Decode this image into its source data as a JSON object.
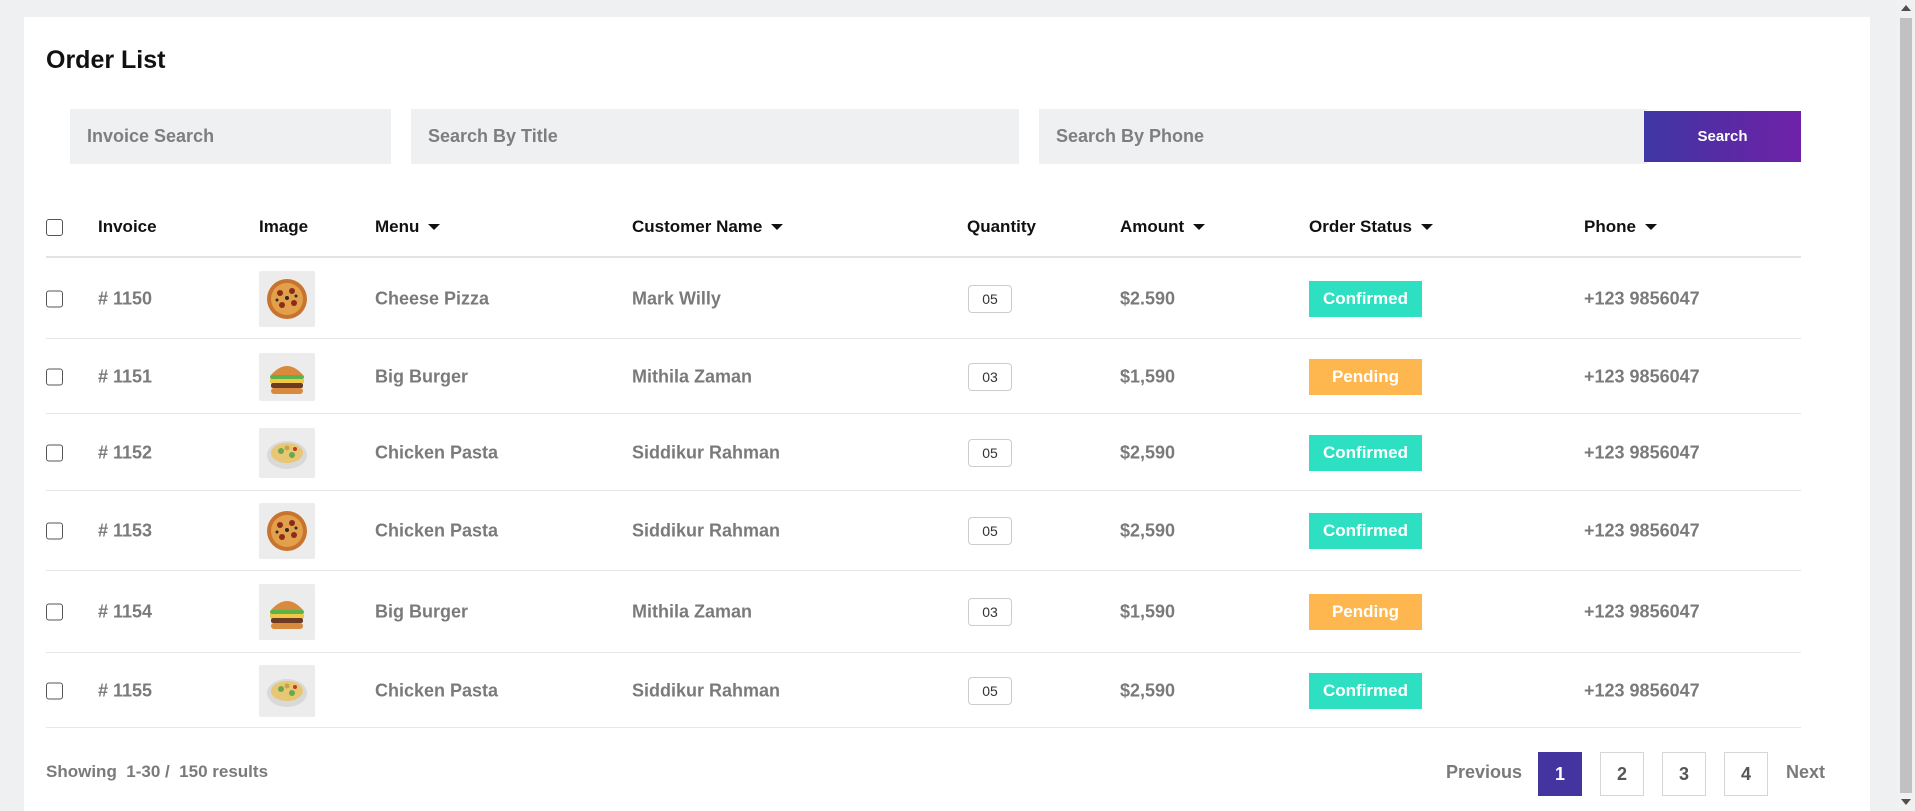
{
  "page_title": "Order List",
  "search": {
    "invoice_placeholder": "Invoice Search",
    "title_placeholder": "Search By Title",
    "phone_placeholder": "Search By Phone",
    "button_label": "Search",
    "button_gradient": [
      "#3f37a5",
      "#6f22a8"
    ]
  },
  "columns": {
    "invoice": "Invoice",
    "image": "Image",
    "menu": "Menu",
    "customer": "Customer Name",
    "quantity": "Quantity",
    "amount": "Amount",
    "status": "Order Status",
    "phone": "Phone"
  },
  "status_colors": {
    "Confirmed": "#2ee0c2",
    "Pending": "#fdb74e"
  },
  "rows": [
    {
      "invoice": "# 1150",
      "image_icon": "pizza-icon",
      "menu": "Cheese Pizza",
      "customer": "Mark Willy",
      "quantity": "05",
      "amount": "$2.590",
      "status": "Confirmed",
      "phone": "+123 9856047"
    },
    {
      "invoice": "# 1151",
      "image_icon": "burger-icon",
      "menu": "Big Burger",
      "customer": "Mithila Zaman",
      "quantity": "03",
      "amount": "$1,590",
      "status": "Pending",
      "phone": "+123 9856047"
    },
    {
      "invoice": "# 1152",
      "image_icon": "pasta-icon",
      "menu": "Chicken Pasta",
      "customer": "Siddikur Rahman",
      "quantity": "05",
      "amount": "$2,590",
      "status": "Confirmed",
      "phone": "+123 9856047"
    },
    {
      "invoice": "# 1153",
      "image_icon": "pizza-icon",
      "menu": "Chicken Pasta",
      "customer": "Siddikur Rahman",
      "quantity": "05",
      "amount": "$2,590",
      "status": "Confirmed",
      "phone": "+123 9856047"
    },
    {
      "invoice": "# 1154",
      "image_icon": "burger-icon",
      "menu": "Big Burger",
      "customer": "Mithila Zaman",
      "quantity": "03",
      "amount": "$1,590",
      "status": "Pending",
      "phone": "+123 9856047"
    },
    {
      "invoice": "# 1155",
      "image_icon": "pasta-icon",
      "menu": "Chicken Pasta",
      "customer": "Siddikur Rahman",
      "quantity": "05",
      "amount": "$2,590",
      "status": "Confirmed",
      "phone": "+123 9856047"
    }
  ],
  "footer": {
    "showing": "Showing  1-30 /  150 results",
    "previous": "Previous",
    "next": "Next",
    "pages": [
      "1",
      "2",
      "3",
      "4"
    ],
    "active_page": "1"
  }
}
